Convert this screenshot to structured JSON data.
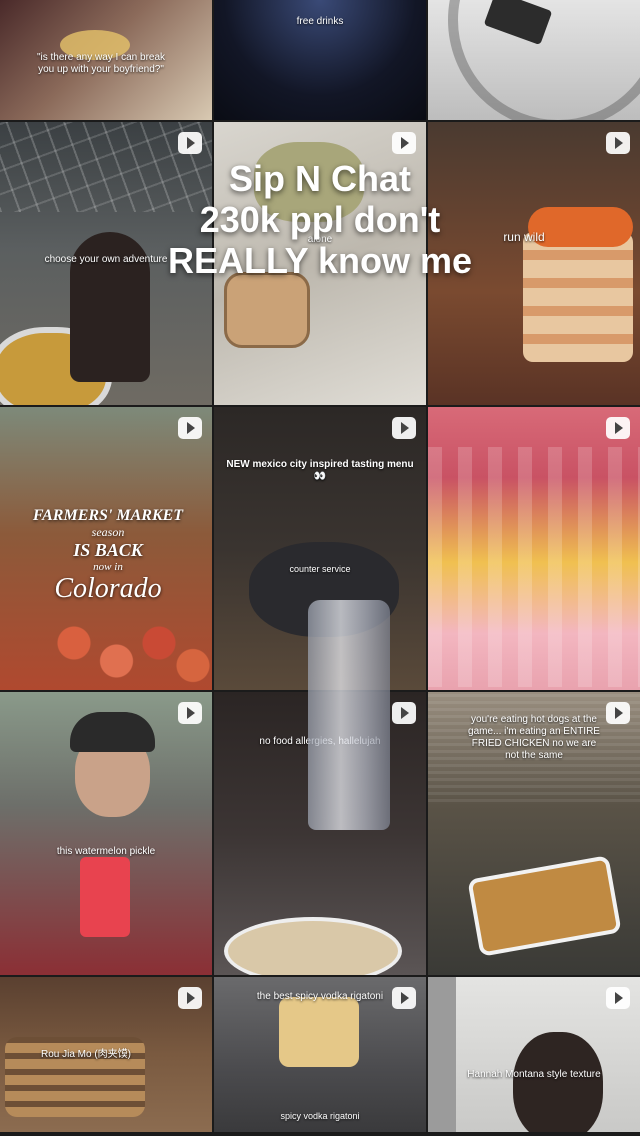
{
  "overlay": {
    "title_lines": [
      "Sip N Chat",
      "230k ppl don't",
      "REALLY know me"
    ]
  },
  "tiles": [
    {
      "caption": "\"is there any way I can break you up with your boyfriend?\"",
      "play": false
    },
    {
      "caption": "free drinks",
      "play": false
    },
    {
      "caption": "",
      "play": false
    },
    {
      "caption": "choose your own adventure",
      "play": true
    },
    {
      "caption": "alone",
      "play": true
    },
    {
      "caption": "run wild",
      "play": true
    },
    {
      "caption": "",
      "play": true,
      "sign": [
        "FARMERS' MARKET",
        "season",
        "IS BACK",
        "now in",
        "Colorado"
      ]
    },
    {
      "caption": "NEW mexico city inspired tasting menu 👀",
      "sub": "counter service",
      "play": true
    },
    {
      "caption": "",
      "play": true
    },
    {
      "caption": "this watermelon pickle",
      "play": true
    },
    {
      "caption": "no food allergies, hallelujah",
      "play": true
    },
    {
      "caption": "you're eating hot dogs at the game... i'm eating an ENTIRE FRIED CHICKEN no we are not the same",
      "play": true
    },
    {
      "caption": "Rou Jia Mo (肉夹馍)",
      "play": true
    },
    {
      "caption": "the best spicy vodka rigatoni",
      "sub": "spicy vodka rigatoni",
      "play": true
    },
    {
      "caption": "Hannah Montana style texture",
      "play": true
    }
  ],
  "colors": {
    "t0": "#6e4b44",
    "t1": "#1e2233",
    "t2": "#c9c9c9",
    "t3": "#4a4f52",
    "t4": "#c8c6c0",
    "t5": "#b06a45",
    "t6": "#8c5a3a",
    "t7": "#3a3430",
    "t8": "#c95264",
    "t9": "#7a7c78",
    "t10": "#3c3534",
    "t11": "#4e4a3f",
    "t12": "#6a4b35",
    "t13": "#5b5b5e",
    "t14": "#d7d7d5"
  }
}
